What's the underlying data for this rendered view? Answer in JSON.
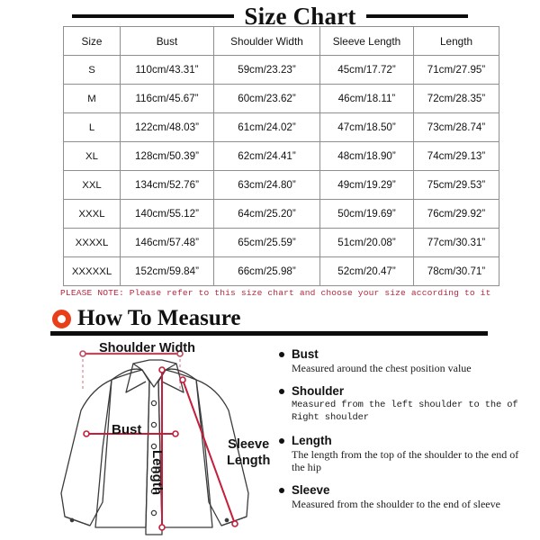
{
  "title": "Size Chart",
  "table": {
    "headers": [
      "Size",
      "Bust",
      "Shoulder Width",
      "Sleeve Length",
      "Length"
    ],
    "rows": [
      {
        "size": "S",
        "bust": "110cm/43.31”",
        "shoulder": "59cm/23.23”",
        "sleeve": "45cm/17.72”",
        "length": "71cm/27.95”"
      },
      {
        "size": "M",
        "bust": "116cm/45.67”",
        "shoulder": "60cm/23.62”",
        "sleeve": "46cm/18.11”",
        "length": "72cm/28.35”"
      },
      {
        "size": "L",
        "bust": "122cm/48.03”",
        "shoulder": "61cm/24.02”",
        "sleeve": "47cm/18.50”",
        "length": "73cm/28.74”"
      },
      {
        "size": "XL",
        "bust": "128cm/50.39”",
        "shoulder": "62cm/24.41”",
        "sleeve": "48cm/18.90”",
        "length": "74cm/29.13”"
      },
      {
        "size": "XXL",
        "bust": "134cm/52.76”",
        "shoulder": "63cm/24.80”",
        "sleeve": "49cm/19.29”",
        "length": "75cm/29.53”"
      },
      {
        "size": "XXXL",
        "bust": "140cm/55.12”",
        "shoulder": "64cm/25.20”",
        "sleeve": "50cm/19.69”",
        "length": "76cm/29.92”"
      },
      {
        "size": "XXXXL",
        "bust": "146cm/57.48”",
        "shoulder": "65cm/25.59”",
        "sleeve": "51cm/20.08”",
        "length": "77cm/30.31”"
      },
      {
        "size": "XXXXXL",
        "bust": "152cm/59.84”",
        "shoulder": "66cm/25.98”",
        "sleeve": "52cm/20.47”",
        "length": "78cm/30.71”"
      }
    ]
  },
  "note": "PLEASE NOTE: Please refer to this size chart and choose your size according to it",
  "how_to_measure": {
    "heading": "How To Measure",
    "bullet_icon": "ring-icon",
    "items": [
      {
        "label": "Bust",
        "text": "Measured around the chest position value"
      },
      {
        "label": "Shoulder",
        "text": "Measured from the left shoulder to the of Right shoulder"
      },
      {
        "label": "Length",
        "text": "The length from the top of the shoulder to the end of the hip"
      },
      {
        "label": "Sleeve",
        "text": "Measured from the shoulder to the end of sleeve"
      }
    ]
  },
  "illustration": {
    "garment": "long-sleeve-shirt",
    "callouts": {
      "shoulder_width": "Shoulder Width",
      "bust": "Bust",
      "sleeve_length": "Sleeve\nLength",
      "sleeve_length_line1": "Sleeve",
      "sleeve_length_line2": "Length",
      "length": "Length"
    }
  },
  "colors": {
    "note_red": "#b5293f",
    "ring_orange": "#e8401a",
    "measure_line_rose": "#c0485f",
    "measure_line_crimson": "#c41e3a",
    "table_border": "#8f8f8f",
    "ink": "#111111"
  }
}
